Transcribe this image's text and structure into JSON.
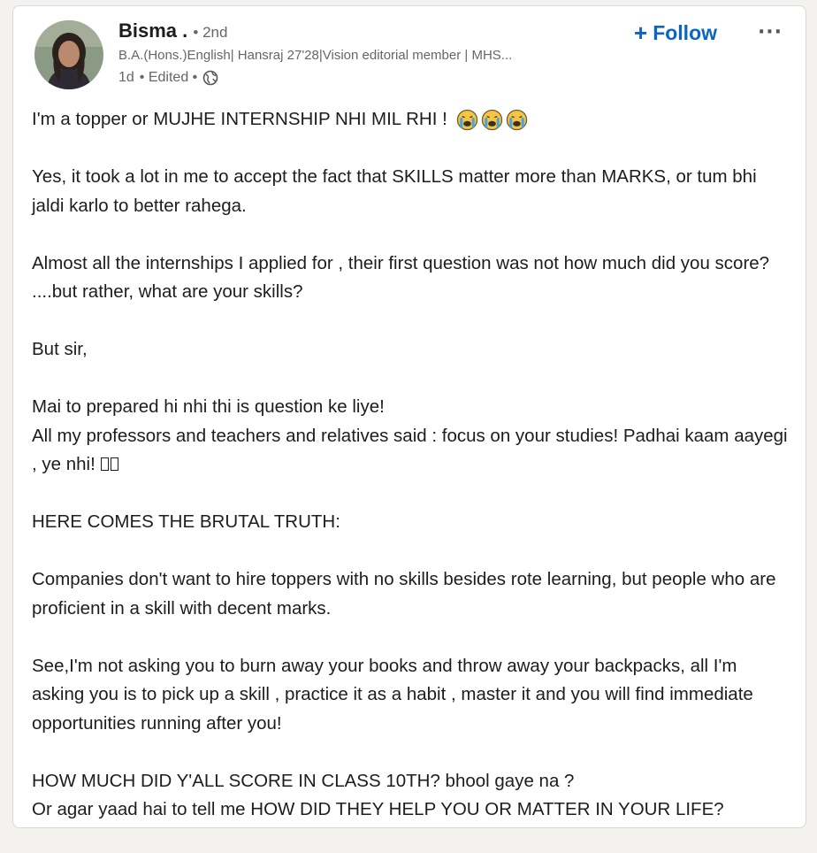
{
  "post": {
    "author": {
      "name": "Bisma .",
      "degree": "• 2nd",
      "headline": "B.A.(Hons.)English| Hansraj 27'28|Vision editorial member | MHS...",
      "time": "1d",
      "edited": "• Edited •",
      "visibility_icon": "globe-icon"
    },
    "actions": {
      "follow_label": "Follow",
      "follow_icon": "plus-icon",
      "more_label": "···"
    },
    "body": {
      "p1": "I'm a topper or MUJHE INTERNSHIP NHI MIL RHI !",
      "p1_emoji": "crying-face-emoji",
      "p2": "Yes, it took a lot in me to accept the fact that SKILLS matter more than MARKS, or tum bhi jaldi karlo to better rahega.",
      "p3": "Almost all the internships I applied for , their first question was not how much did you score? ....but rather, what are your skills?",
      "p4": "But sir,",
      "p5_line1": "Mai to prepared hi nhi thi is question ke liye!",
      "p5_line2": "All my professors and teachers and relatives said : focus on your studies! Padhai kaam aayegi , ye nhi!",
      "p5_missing_glyphs": "missing-glyph-boxes",
      "p6": "HERE COMES THE BRUTAL TRUTH:",
      "p7": "Companies don't want to hire toppers with no skills besides rote learning, but people who are proficient in a skill with decent marks.",
      "p8": "See,I'm not asking you to burn away your books and throw away your backpacks, all I'm asking you is to pick up a skill , practice it as a habit , master it and you will find immediate opportunities running after you!",
      "p9_line1": "HOW MUCH DID Y'ALL SCORE IN CLASS 10TH? bhool gaye na ?",
      "p9_line2": "Or agar yaad hai to tell me HOW DID THEY HELP YOU OR MATTER IN YOUR LIFE?"
    }
  },
  "colors": {
    "link_blue": "#0a66c2",
    "text": "#1d1d1d",
    "muted": "#666666",
    "page_bg": "#f4f2ee",
    "card_bg": "#ffffff"
  }
}
